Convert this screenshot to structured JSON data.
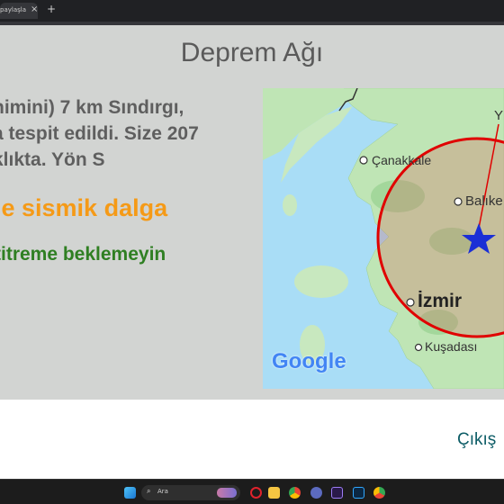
{
  "browser": {
    "tab_title": "paylaşla",
    "tab_close": "×",
    "new_tab": "+"
  },
  "app": {
    "title": "Deprem Ağı",
    "description_lines": [
      "himini) 7 km Sındırgı,",
      "a tespit edildi. Size 207",
      "klıkta. Yön S"
    ],
    "wave_text": "le sismik dalga",
    "advice_text": "titreme beklemeyin",
    "exit_button": "Çıkış",
    "colors": {
      "background": "#d2d4d2",
      "wave": "#f59a17",
      "advice": "#2f7f22",
      "exit": "#0c5c66",
      "radius_circle": "#e00000",
      "epicenter_star": "#1a2fd6"
    }
  },
  "map": {
    "labels": {
      "canakkale": "Çanakkale",
      "balikesir": "Balıke",
      "izmir": "İzmir",
      "kusadasi": "Kuşadası",
      "north_partial": "Y"
    },
    "google_logo": "Google"
  },
  "taskbar": {
    "search_placeholder": "Ara",
    "icons": [
      "windows-start-icon",
      "search-icon",
      "news-widget-icon",
      "opera-icon",
      "file-explorer-icon",
      "chrome-icon",
      "meet-icon",
      "premiere-icon",
      "photoshop-icon",
      "chrome-alt-icon"
    ]
  }
}
